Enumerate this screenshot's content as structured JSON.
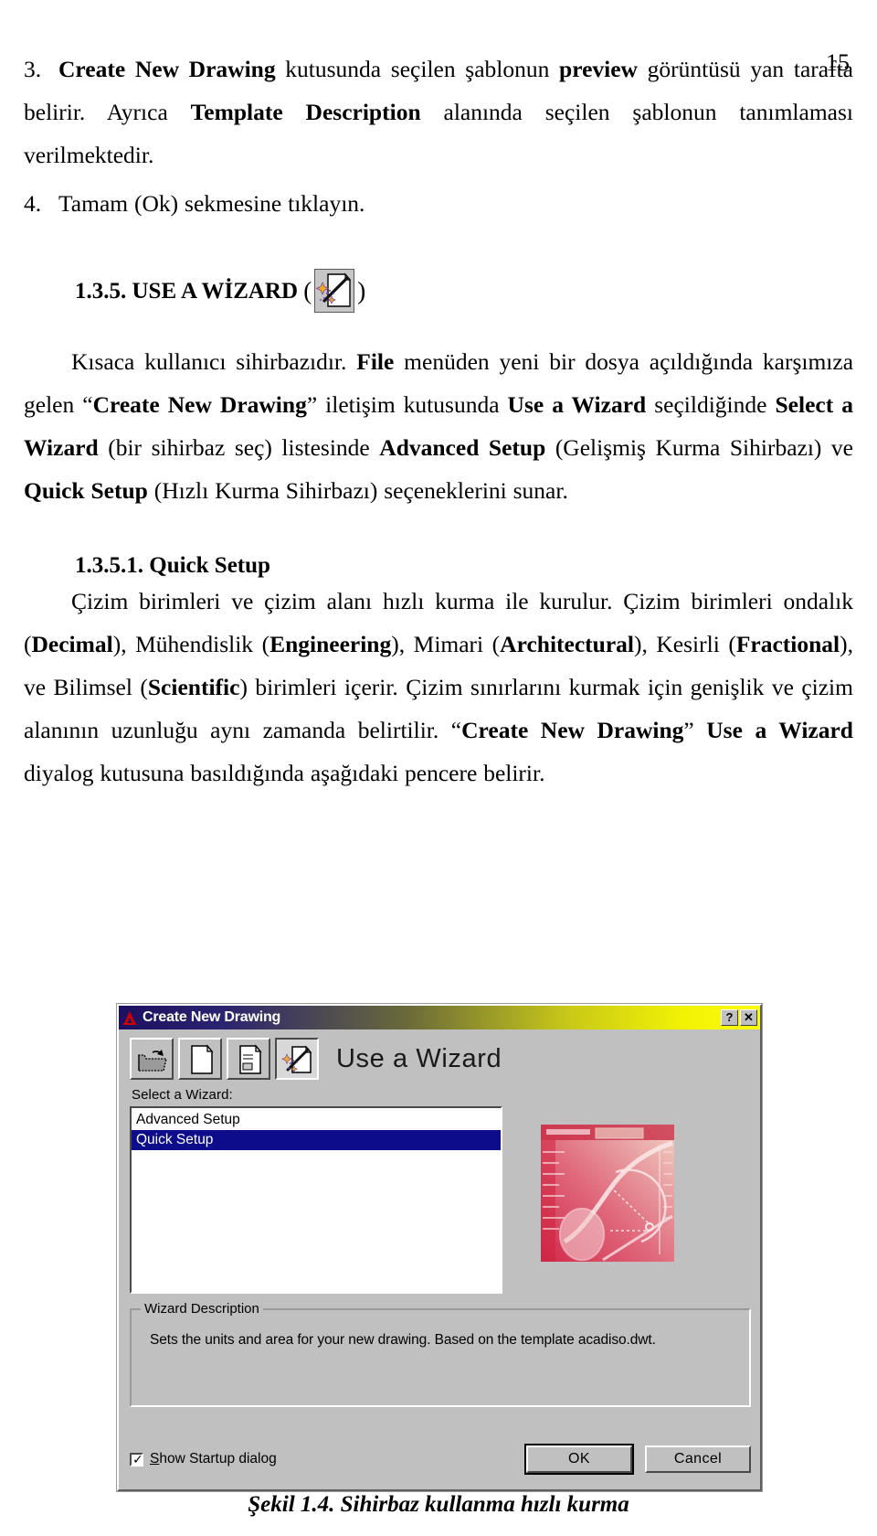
{
  "page": {
    "number": "15"
  },
  "items": {
    "item3": {
      "marker": "3.",
      "seg1_bold": "Create New Drawing",
      "seg2": " kutusunda seçilen şablonun ",
      "seg3_bold": "preview",
      "seg4": " görüntüsü yan tarafta belirir. Ayrıca ",
      "seg5_bold": "Template Description",
      "seg6": " alanında seçilen şablonun tanımlaması verilmektedir."
    },
    "item4": {
      "marker": "4.",
      "text": "Tamam (Ok) sekmesine tıklayın."
    }
  },
  "heading_wizard": {
    "number": "1.3.5.",
    "title": "USE A WİZARD",
    "paren_open": "(",
    "paren_close": ")",
    "icon": "wizard-page-icon"
  },
  "intro_paragraph": {
    "s1": "Kısaca kullanıcı sihirbazıdır. ",
    "s2_bold": "File",
    "s3": " menüden yeni bir dosya açıldığında karşımıza gelen “",
    "s4_bold": "Create New Drawing",
    "s5": "” iletişim kutusunda ",
    "s6_bold": "Use a Wizard",
    "s7": " seçildiğinde ",
    "s8_bold": "Select a Wizard",
    "s9": " (bir sihirbaz seç) listesinde ",
    "s10_bold": "Advanced Setup",
    "s11": " (Gelişmiş Kurma Sihirbazı) ve ",
    "s12_bold": "Quick Setup",
    "s13": " (Hızlı Kurma Sihirbazı) seçeneklerini sunar."
  },
  "subheading_quick": {
    "number": "1.3.5.1.",
    "title": "Quick Setup"
  },
  "quick_paragraph": {
    "s1": "Çizim birimleri ve çizim alanı hızlı kurma ile kurulur. Çizim birimleri ondalık (",
    "s2_bold": "Decimal",
    "s3": "), Mühendislik (",
    "s4_bold": "Engineering",
    "s5": "), Mimari (",
    "s6_bold": "Architectural",
    "s7": "), Kesirli (",
    "s8_bold": "Fractional",
    "s9": "), ve Bilimsel (",
    "s10_bold": "Scientific",
    "s11": ") birimleri içerir. Çizim sınırlarını kurmak için genişlik ve çizim alanının uzunluğu aynı zamanda belirtilir. “",
    "s12_bold": "Create New Drawing",
    "s13": "” ",
    "s14_bold": "Use a Wizard",
    "s15": " diyalog kutusuna basıldığında aşağıdaki pencere belirir."
  },
  "dialog": {
    "title": "Create New Drawing",
    "titlebar": {
      "help_button": "?",
      "close_button": "✕",
      "gradient_left": "#1d1060",
      "gradient_right": "#fbfb0a"
    },
    "toolbar": {
      "buttons": [
        {
          "name": "open-drawing-icon",
          "label": "Open a Drawing",
          "pressed": false
        },
        {
          "name": "start-from-scratch-icon",
          "label": "Start from Scratch",
          "pressed": false
        },
        {
          "name": "use-a-template-icon",
          "label": "Use a Template",
          "pressed": false
        },
        {
          "name": "use-a-wizard-icon",
          "label": "Use a Wizard",
          "pressed": true
        }
      ]
    },
    "mode_title": "Use a Wizard",
    "select_wizard_label": "Select a Wizard:",
    "wizard_list": [
      {
        "label": "Advanced Setup",
        "selected": false
      },
      {
        "label": "Quick Setup",
        "selected": true
      }
    ],
    "selection_color": "#0d0d8c",
    "preview": {
      "name": "wizard-preview-thumbnail",
      "accent_color": "#d94a5c"
    },
    "description_group": {
      "legend": "Wizard Description",
      "text": "Sets the units and area for your new drawing. Based on the template acadiso.dwt."
    },
    "show_startup": {
      "label_accel": "S",
      "label_rest": "how Startup dialog",
      "checked": true
    },
    "buttons": {
      "ok": "OK",
      "cancel": "Cancel"
    }
  },
  "figure_caption": "Şekil 1.4. Sihirbaz kullanma hızlı kurma"
}
